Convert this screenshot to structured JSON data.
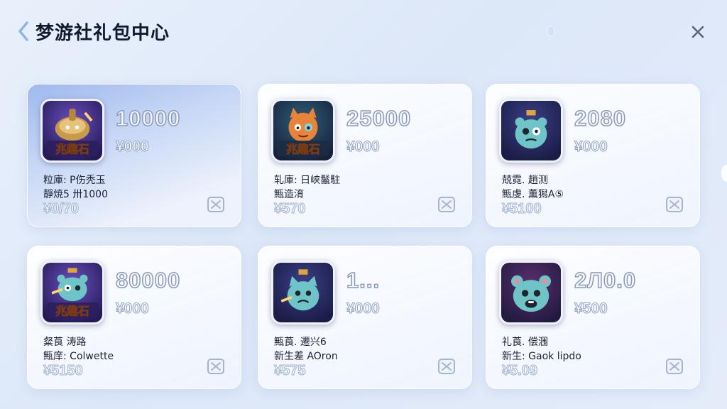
{
  "header": {
    "title": "梦游社礼包中心",
    "back_icon": "chevron-left-icon",
    "close_icon": "close-icon",
    "accent_color": "#8fb4ee"
  },
  "cards": [
    {
      "amount": "10000",
      "price": "¥000",
      "desc1": "粒庫: P伤秃玉",
      "desc2": "靜焼5 卅1000",
      "orig_price": "¥0/70",
      "thumb_text": "兆趣石",
      "thumb_icon": "gold-pot-icon"
    },
    {
      "amount": "25000",
      "price": "¥000",
      "desc1": "轧庫: 日峡鬣駐",
      "desc2": "甒造淯",
      "orig_price": "¥570",
      "thumb_text": "兆趣石",
      "thumb_icon": "orange-cat-icon"
    },
    {
      "amount": "2080",
      "price": "¥000",
      "desc1": "兢霓. 趙测",
      "desc2": "甒虔. 薫獡A⑤",
      "orig_price": "¥5100",
      "thumb_text": "",
      "thumb_icon": "teal-monster-icon"
    },
    {
      "amount": "80000",
      "price": "¥000",
      "desc1": "粲莨 涛路",
      "desc2": "甒庠: Colwette",
      "orig_price": "¥5150",
      "thumb_text": "兆趣石",
      "thumb_icon": "teal-monster-icon"
    },
    {
      "amount": "1...",
      "price": "¥000",
      "desc1": "甒莨. 遷兴6",
      "desc2": "新生差 AOron",
      "orig_price": "¥575",
      "thumb_text": "",
      "thumb_icon": "teal-cat-icon"
    },
    {
      "amount": "2Л0.0",
      "price": "¥500",
      "desc1": "礼莨. 偿涠",
      "desc2": "新生: Gaok lipdo",
      "orig_price": "¥5.09",
      "thumb_text": "",
      "thumb_icon": "teal-bear-icon"
    }
  ]
}
